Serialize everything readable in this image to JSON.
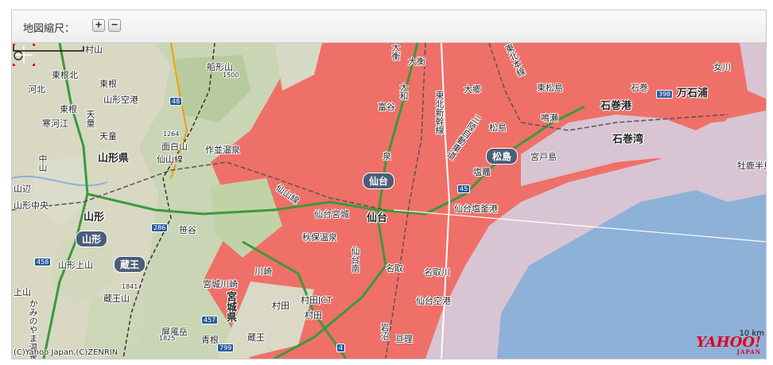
{
  "toolbar": {
    "zoom_label": "地図縮尺：",
    "zoom_in": "+",
    "zoom_out": "−"
  },
  "map": {
    "labels": {
      "murayama": "村山",
      "higashine_ic": "東根北",
      "kawakita": "河北",
      "higashine_station": "東根",
      "yamagata_airport": "山形空港",
      "higashine_city": "東根",
      "sagae": "寒河江",
      "tendo_v": "天童",
      "tendo": "天童",
      "yamagata_pref": "山形県",
      "nakayama": "中山",
      "yamabe": "山辺",
      "yamagata_chuo": "山形中央",
      "yamagata_city": "山形",
      "yamagata_kami": "山形上山",
      "kaminoyama": "上山",
      "kamiyama_onsen": "かみのやま温泉",
      "funagata": "船形山",
      "funagata_elev": "1500",
      "menshiro": "面白山",
      "menshiro_elev": "1264",
      "senzan_line": "仙山線",
      "sakunami": "作並温泉",
      "akiu": "秋保温泉",
      "sasaya": "笹谷",
      "zao_pill": "蔵王",
      "zaosan": "蔵王山",
      "zaosan_elev": "1841",
      "byobu": "屏風岳",
      "byobu_elev": "1825",
      "aone": "青根",
      "zao_town": "蔵王",
      "kawasaki": "川崎",
      "miyagi_kawasaki": "宮城川崎",
      "miyagi_pref": "宮城県",
      "murata_jct": "村田JCT",
      "murata": "村田",
      "murata2": "村田",
      "sendai_miyagi": "仙台宮城",
      "sendai_pill": "仙台",
      "sendai": "仙台",
      "sendai_minami": "仙台南",
      "izumi": "泉",
      "tomiya": "富谷",
      "taiwa": "大和",
      "daira": "大衡",
      "daira2": "大衡",
      "osato": "大郷",
      "tohoku_shinkansen": "東北新幹線",
      "tohoku_honsen": "東北本線",
      "sanriku": "三陸自動車道",
      "matsushima": "松島",
      "matsushima_pill": "松島",
      "higashi_matsushima": "東松島",
      "naruse": "鳴瀬",
      "ishinomaki": "石巻",
      "ishinomaki_port": "石巻港",
      "ishinomaki_bay": "石巻湾",
      "mangoku": "万石浦",
      "onagawa": "女川",
      "oshika": "牡鹿半島",
      "miyato": "宮戸島",
      "shiogama": "塩竈",
      "sendai_shiogama": "仙台塩釜港",
      "natori": "名取",
      "natori_river": "名取川",
      "sendai_airport": "仙台空港",
      "iwanuma": "岩沼",
      "watari": "亘理",
      "route_48": "48",
      "route_286": "286",
      "route_457": "457",
      "route_458": "458",
      "route_45": "45",
      "route_4": "4",
      "route_398": "398",
      "route_799": "799"
    },
    "copyright": "(C)Yahoo Japan,(C)ZENRIN",
    "scale_label": "10 km",
    "logo": "YAHOO!",
    "logo_sub": "JAPAN",
    "colors": {
      "urban": "#ef7068",
      "mountain": "#d9d9c6",
      "forest": "#b7cc9e",
      "sea": "#8aaed6",
      "sea_light": "#d7c2d0",
      "road": "#3a9a3a"
    }
  }
}
